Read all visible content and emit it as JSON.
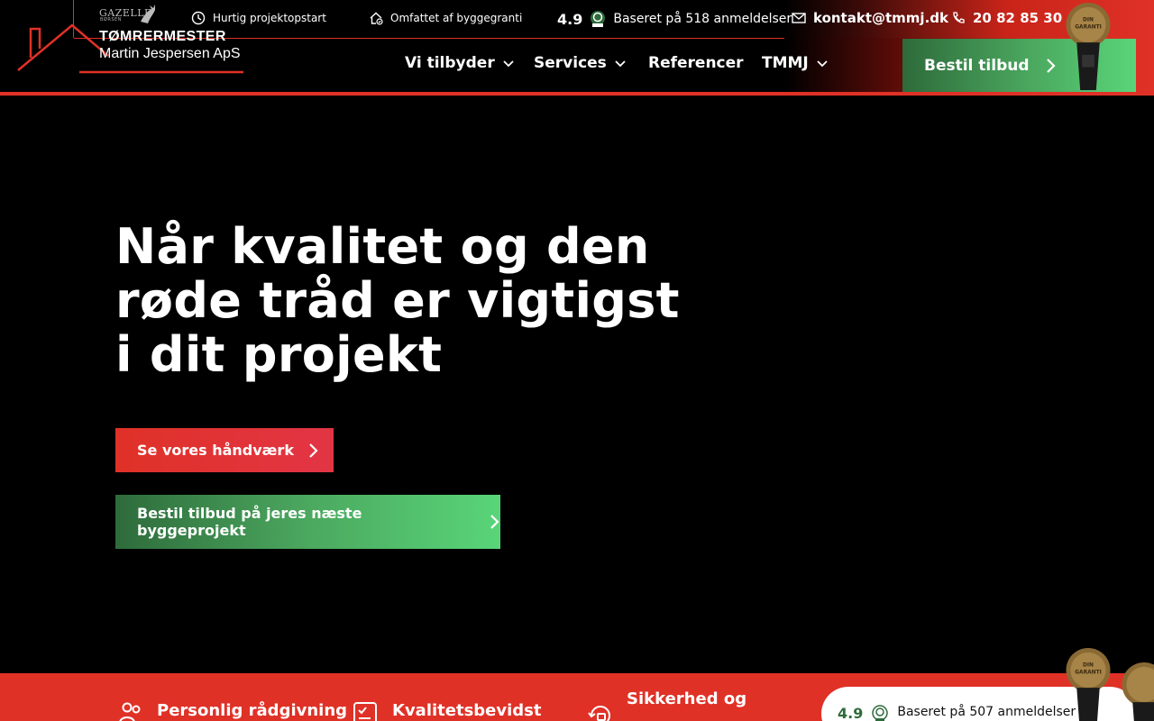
{
  "logo": {
    "gazelle": "GAZELLE",
    "borsen": "BØRSEN",
    "title": "TØMRERMESTER",
    "subtitle": "Martin Jespersen ApS"
  },
  "topbar": {
    "quick_start": "Hurtig projektopstart",
    "guarantee": "Omfattet af byggegranti",
    "rating_score": "4.9",
    "rating_text": "Baseret på 518 anmeldelser",
    "email": "kontakt@tmmj.dk",
    "phone": "20 82 85 30"
  },
  "nav": {
    "items": [
      {
        "label": "Vi tilbyder",
        "has_dropdown": true
      },
      {
        "label": "Services",
        "has_dropdown": true
      },
      {
        "label": "Referencer",
        "has_dropdown": false
      },
      {
        "label": "TMMJ",
        "has_dropdown": true
      }
    ],
    "order_button": "Bestil tilbud"
  },
  "hero": {
    "title_line1": "Når kvalitet og den",
    "title_line2": "røde tråd er vigtigst",
    "title_line3": "i dit projekt",
    "primary_button": "Se vores håndværk",
    "secondary_button": "Bestil tilbud på jeres næste byggeprojekt"
  },
  "features": {
    "item1": "Personlig rådgivning",
    "item2": "Kvalitetsbevidst",
    "item3_line1": "Sikkerhed og"
  },
  "review_pill": {
    "score": "4.9",
    "text": "Baseret på 507 anmeldelser"
  },
  "badge_text": "DIN GARANTI HÅNDVÆRK",
  "colors": {
    "brand_red": "#e03127",
    "brand_green": "#59d579",
    "dark_green": "#2e6b3b",
    "background": "#000000"
  }
}
